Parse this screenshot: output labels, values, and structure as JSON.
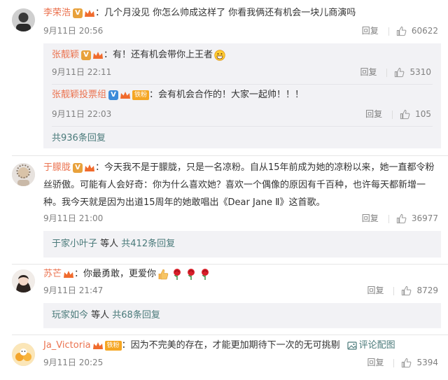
{
  "comments": [
    {
      "user": "李荣浩",
      "text": "：几个月没见 你怎么帅成这样了 你看我俩还有机会一块儿商演吗",
      "time": "9月11日 20:56",
      "reply": "回复",
      "likes": "60622",
      "subreplies": [
        {
          "user": "张靓颖",
          "text": "：有！还有机会带你上王者",
          "time": "9月11日 22:11",
          "reply": "回复",
          "likes": "5310"
        },
        {
          "user": "张靓颖投票组",
          "fan_badge": "铁粉",
          "text": "：会有机会合作的！大家一起帅！！！",
          "time": "9月11日 22:03",
          "reply": "回复",
          "likes": "105"
        }
      ],
      "more": "共936条回复"
    },
    {
      "user": "于朦胧",
      "text1": "：今天我不是于朦胧，只是一名凉粉。自从15年前成为她的凉粉以来，她一直都令粉",
      "text2": "丝骄傲。可能有人会好奇：你为什么喜欢她？喜欢一个偶像的原因有千百种，也许每天都新增一",
      "text3": "种。我今天就是因为出道15周年的她敢唱出《Dear Jane Ⅱ》这首歌。",
      "time": "9月11日 21:00",
      "reply": "回复",
      "likes": "36977",
      "more_user": "于家小叶子",
      "more_mid": " 等人 ",
      "more": "共412条回复"
    },
    {
      "user": "苏芒",
      "text": "：你最勇敢，更爱你",
      "time": "9月11日 21:47",
      "reply": "回复",
      "likes": "8729",
      "more_user": "玩家如今",
      "more_mid": " 等人 ",
      "more": "共68条回复"
    },
    {
      "user": "Ja_Victoria",
      "fan_badge": "铁粉",
      "text": "：因为不完美的存在，才能更加期待下一次的无可挑剔",
      "image_link": "评论配图",
      "time": "9月11日 20:25",
      "reply": "回复",
      "likes": "5394"
    }
  ]
}
